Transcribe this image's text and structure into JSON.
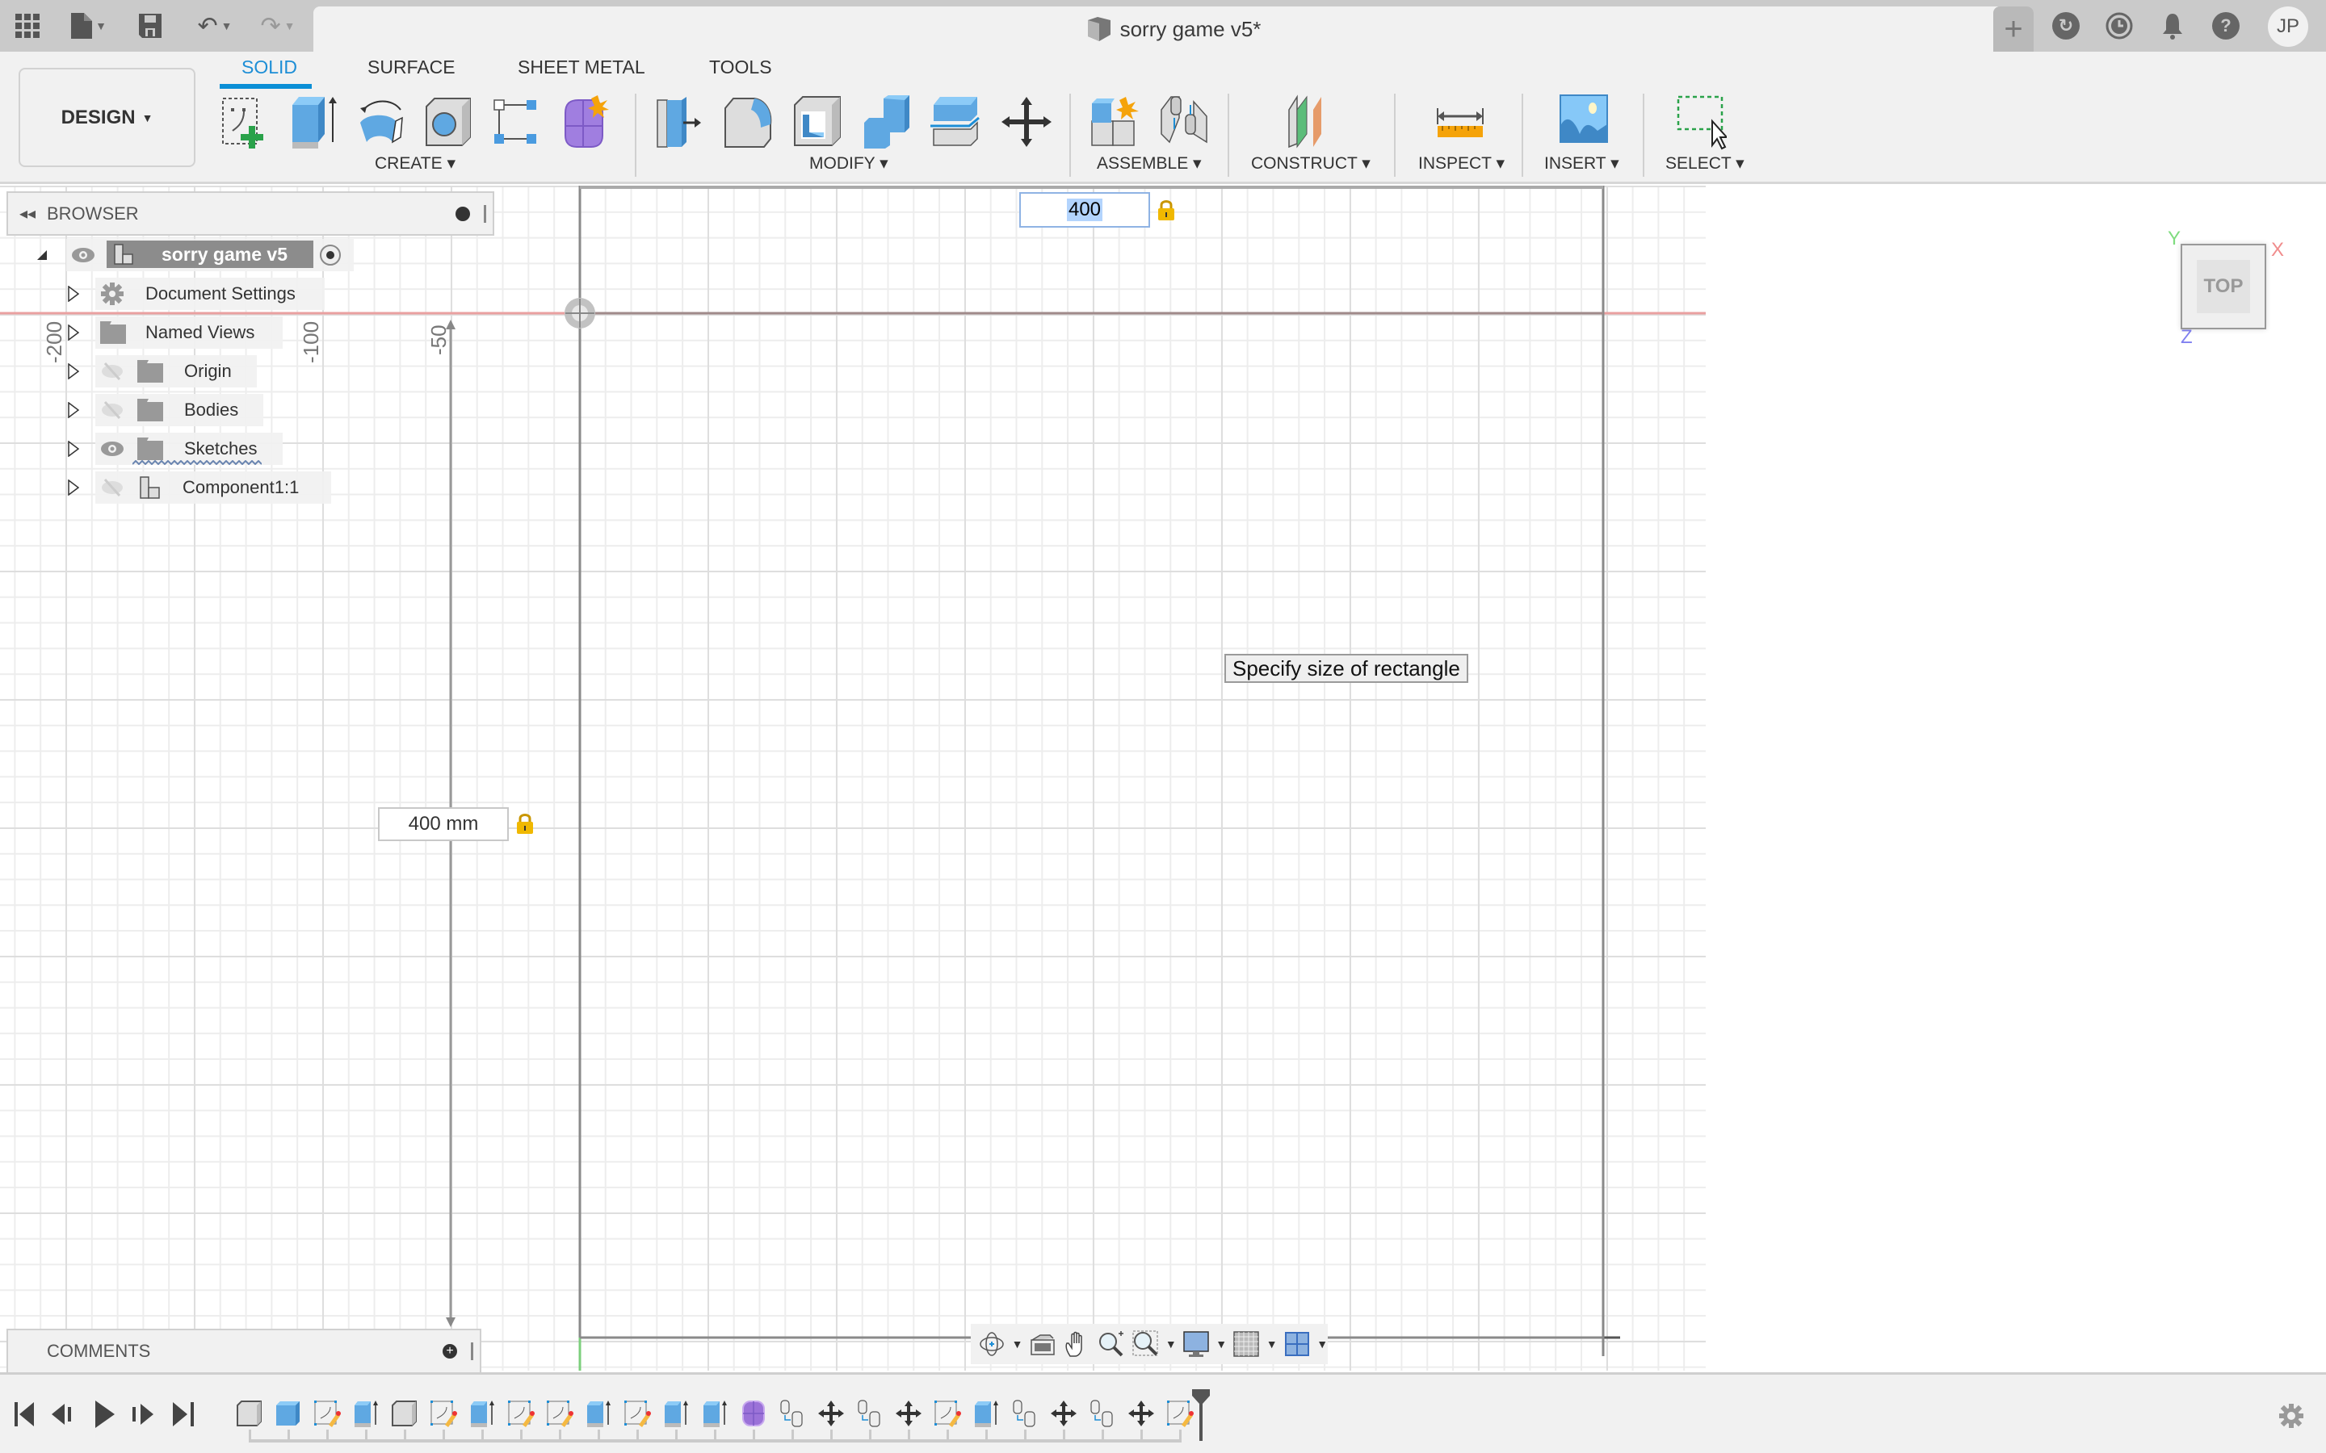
{
  "titlebar": {
    "document_title": "sorry game v5*",
    "close_label": "×",
    "new_tab_label": "+",
    "user_initials": "JP",
    "icons": [
      "apps-grid-icon",
      "file-icon",
      "save-icon",
      "undo-icon",
      "redo-icon",
      "extensions-icon",
      "job-status-icon",
      "notifications-bell-icon",
      "help-icon"
    ]
  },
  "ribbon": {
    "workspace_label": "DESIGN",
    "tabs": [
      {
        "label": "SOLID",
        "active": true
      },
      {
        "label": "SURFACE",
        "active": false
      },
      {
        "label": "SHEET METAL",
        "active": false
      },
      {
        "label": "TOOLS",
        "active": false
      }
    ],
    "groups": [
      {
        "label": "CREATE",
        "tools": [
          "create-sketch",
          "extrude",
          "revolve",
          "hole",
          "pattern",
          "create-form"
        ]
      },
      {
        "label": "MODIFY",
        "tools": [
          "press-pull",
          "fillet",
          "shell",
          "combine",
          "split-body",
          "move-copy"
        ]
      },
      {
        "label": "ASSEMBLE",
        "tools": [
          "new-component",
          "joint"
        ]
      },
      {
        "label": "CONSTRUCT",
        "tools": [
          "offset-plane"
        ]
      },
      {
        "label": "INSPECT",
        "tools": [
          "measure"
        ]
      },
      {
        "label": "INSERT",
        "tools": [
          "insert-image"
        ]
      },
      {
        "label": "SELECT",
        "tools": [
          "window-select"
        ]
      }
    ]
  },
  "browser": {
    "title": "BROWSER",
    "root": {
      "label": "sorry game v5",
      "visible": true,
      "active": true
    },
    "items": [
      {
        "label": "Document Settings",
        "icon": "gear-icon",
        "visibility": "none"
      },
      {
        "label": "Named Views",
        "icon": "folder-icon",
        "visibility": "none"
      },
      {
        "label": "Origin",
        "icon": "folder-icon",
        "visibility": "hidden"
      },
      {
        "label": "Bodies",
        "icon": "folder-icon",
        "visibility": "hidden"
      },
      {
        "label": "Sketches",
        "icon": "folder-icon",
        "visibility": "visible"
      },
      {
        "label": "Component1:1",
        "icon": "component-icon",
        "visibility": "hidden"
      }
    ]
  },
  "comments": {
    "title": "COMMENTS"
  },
  "canvas": {
    "ruler_labels": [
      "-200",
      "-100",
      "-50"
    ],
    "dimension_width": {
      "value": "400",
      "locked": true
    },
    "dimension_height": {
      "value": "400 mm",
      "locked": true
    },
    "tooltip": "Specify size of rectangle",
    "viewcube": {
      "face": "TOP",
      "axes": {
        "x": "X",
        "y": "Y",
        "z": "Z"
      }
    },
    "colors": {
      "x_axis": "#e88a8a",
      "y_axis": "#6fcf6f",
      "z_axis": "#7a7af0",
      "grid_major": "#dedede",
      "grid_minor": "#ededed"
    }
  },
  "navbar": {
    "tools": [
      "orbit-icon",
      "look-at-icon",
      "pan-icon",
      "zoom-icon",
      "fit-icon",
      "display-settings-icon",
      "grid-snap-icon",
      "viewports-icon"
    ]
  },
  "timeline": {
    "controls": [
      "go-to-start",
      "step-back",
      "play",
      "step-forward",
      "go-to-end"
    ],
    "items": [
      "box-white",
      "box-blue",
      "sketch",
      "extrude",
      "box-white",
      "sketch",
      "extrude",
      "sketch",
      "sketch",
      "extrude",
      "sketch",
      "extrude",
      "extrude",
      "form",
      "joint",
      "move",
      "joint",
      "move",
      "sketch",
      "extrude",
      "joint",
      "move",
      "joint",
      "move",
      "sketch"
    ]
  }
}
